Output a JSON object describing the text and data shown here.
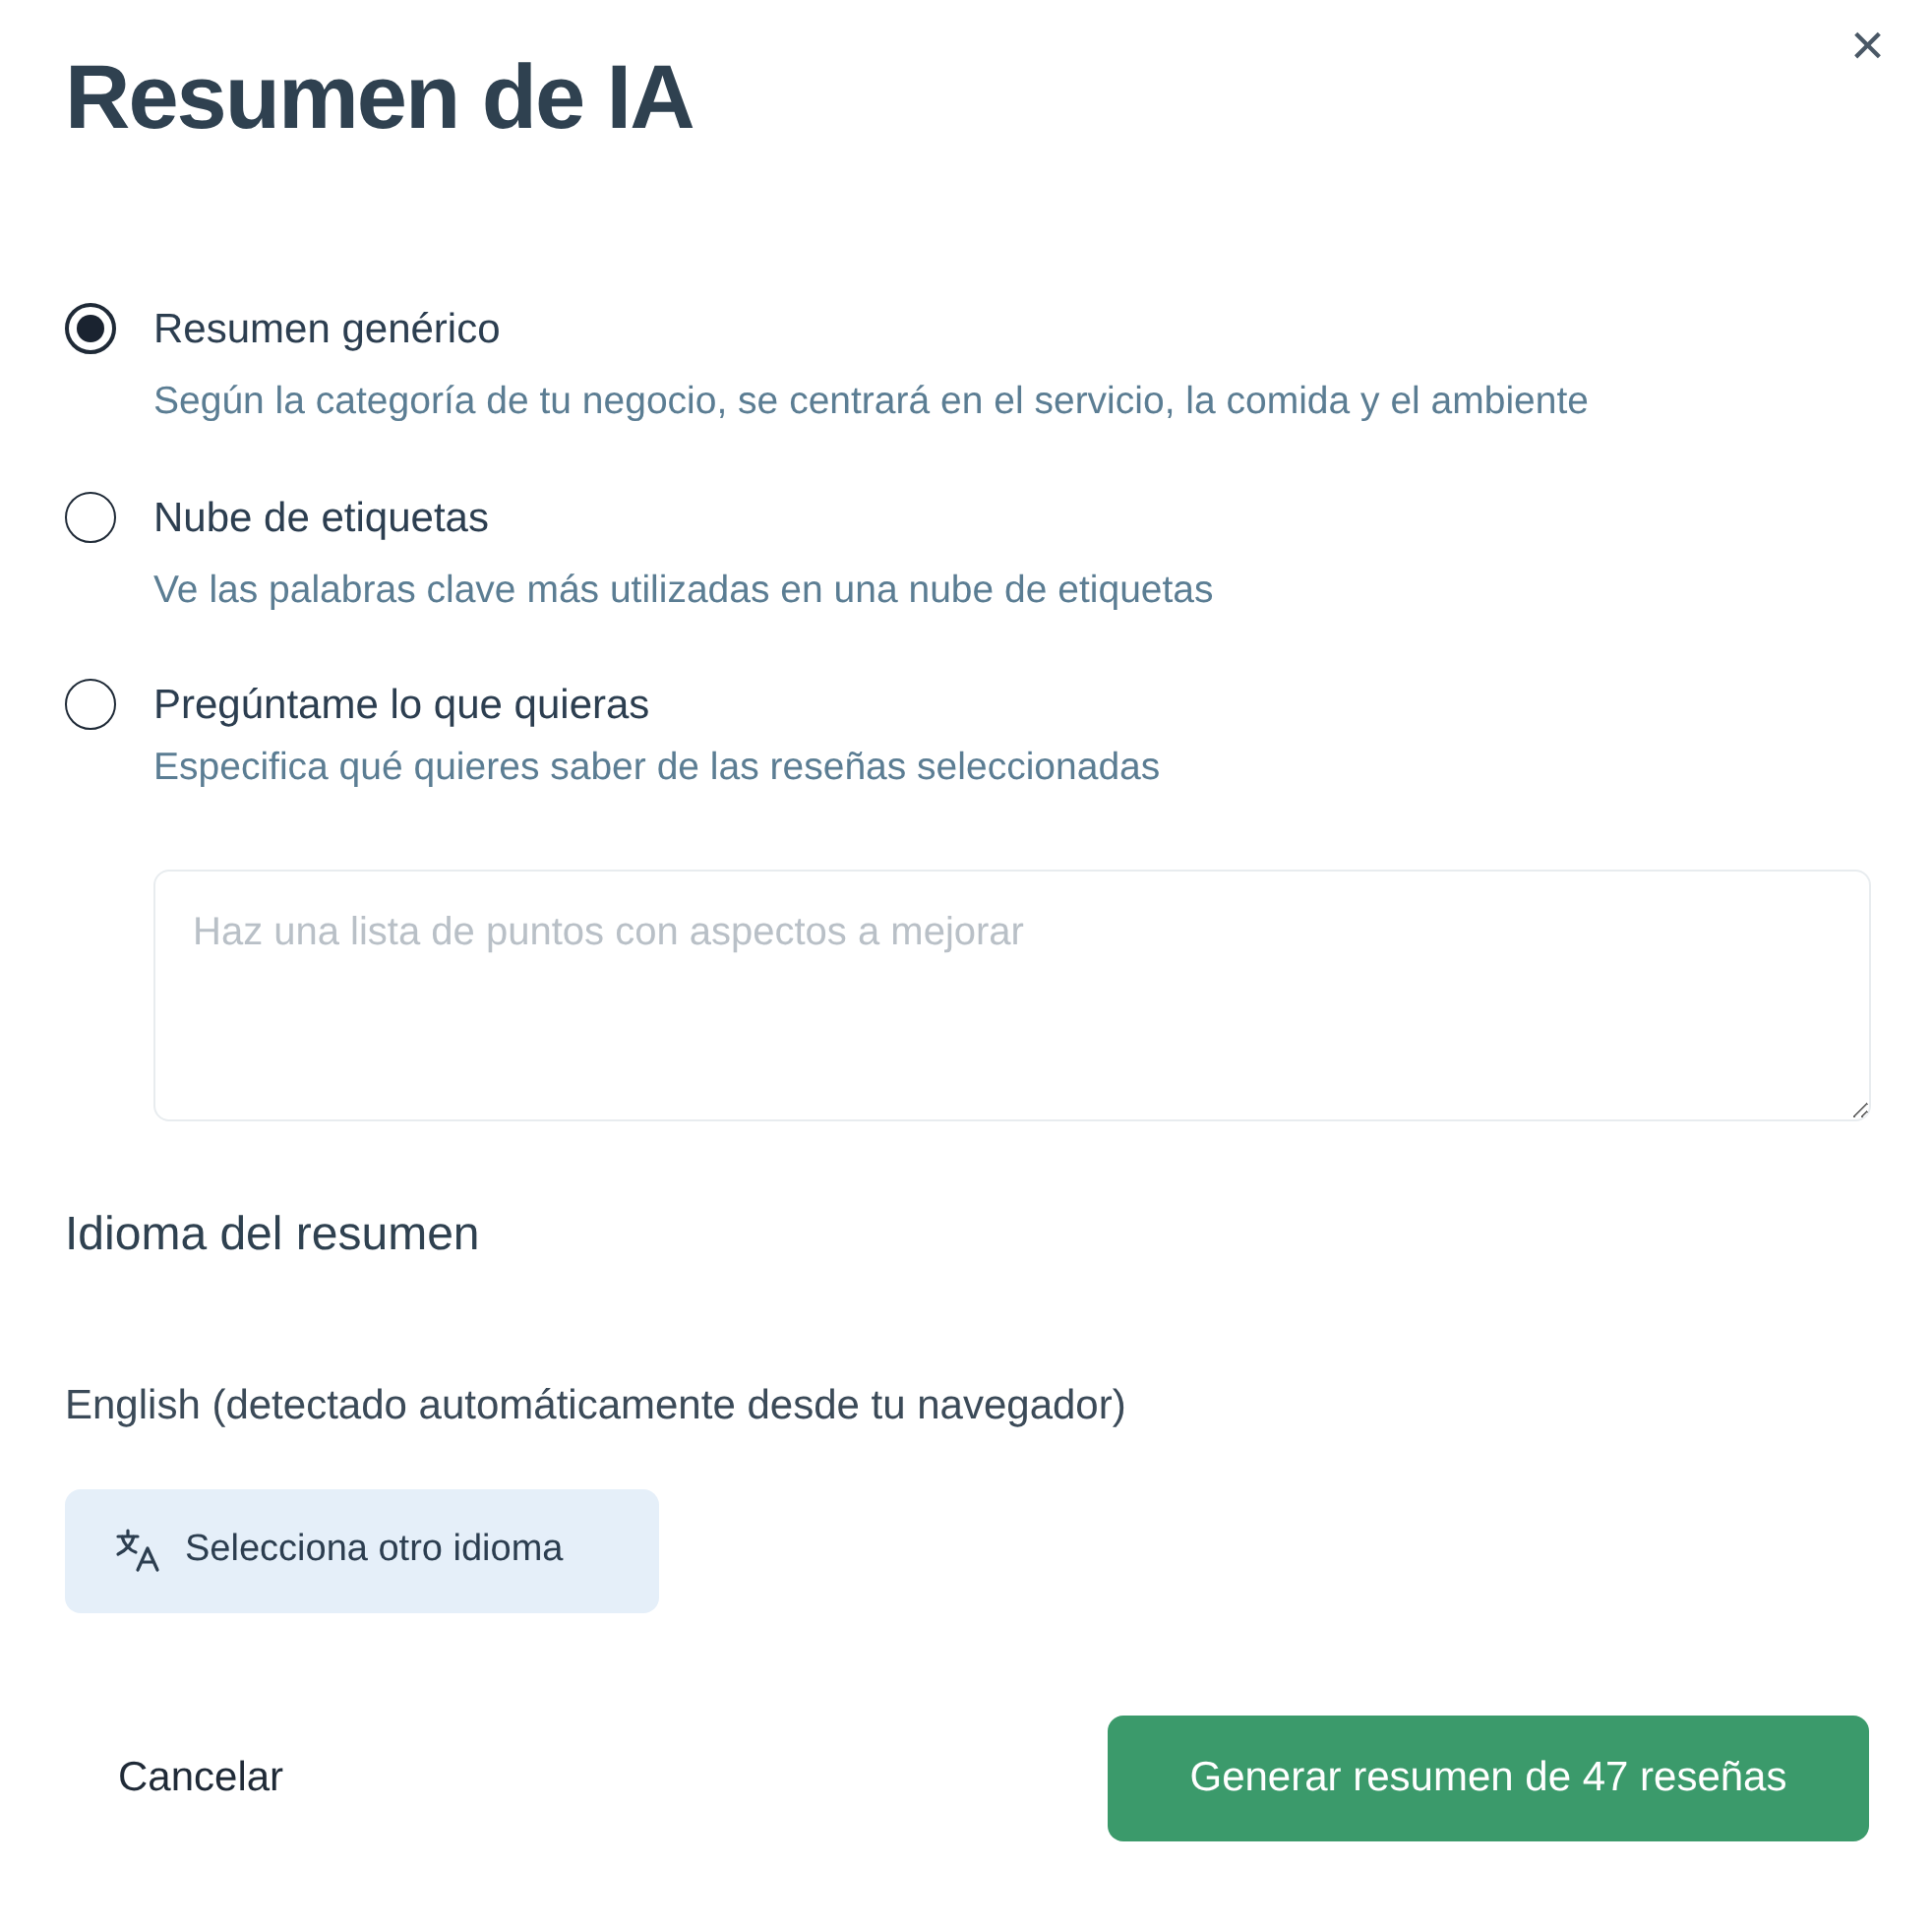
{
  "dialog": {
    "title": "Resumen de IA",
    "close": "×"
  },
  "options": [
    {
      "label": "Resumen genérico",
      "description": "Según la categoría de tu negocio, se centrará en el servicio, la comida y el ambiente",
      "selected": true
    },
    {
      "label": "Nube de etiquetas",
      "description": "Ve las palabras clave más utilizadas en una nube de etiquetas",
      "selected": false
    },
    {
      "label": "Pregúntame lo que quieras",
      "description": "Especifica qué quieres saber de las reseñas seleccionadas",
      "selected": false
    }
  ],
  "question": {
    "placeholder": "Haz una lista de puntos con aspectos a mejorar"
  },
  "language": {
    "heading": "Idioma del resumen",
    "detected": "English (detectado automáticamente desde tu navegador)",
    "change_button": "Selecciona otro idioma"
  },
  "footer": {
    "cancel": "Cancelar",
    "submit": "Generar resumen de 47 reseñas"
  }
}
